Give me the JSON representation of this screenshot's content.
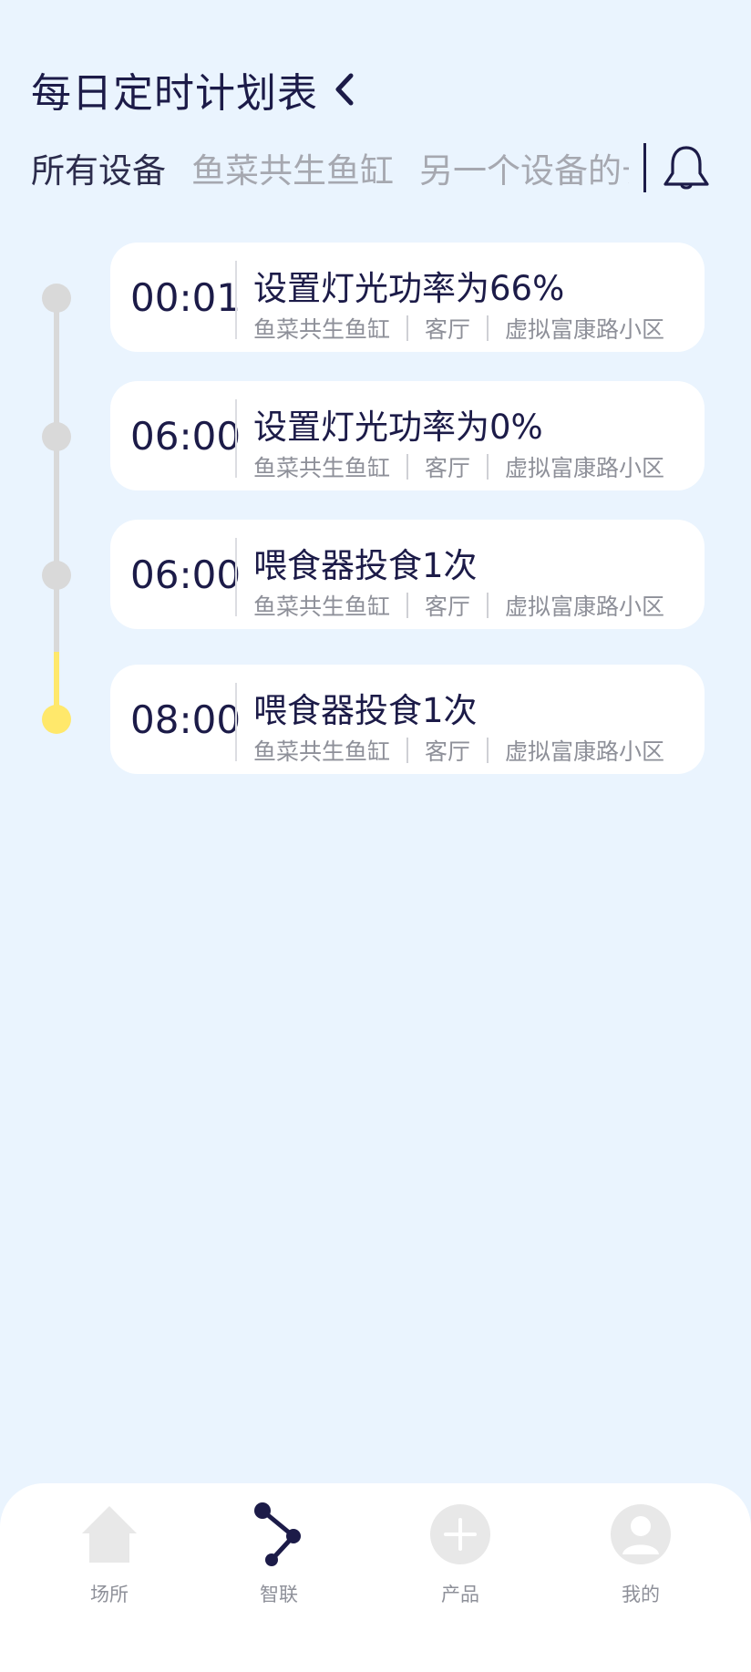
{
  "header": {
    "title": "每日定时计划表"
  },
  "tabs": [
    {
      "label": "所有设备",
      "active": true
    },
    {
      "label": "鱼菜共生鱼缸",
      "active": false
    },
    {
      "label": "另一个设备的长",
      "active": false
    }
  ],
  "schedule": [
    {
      "time": "00:01",
      "action": "设置灯光功率为66%",
      "device": "鱼菜共生鱼缸",
      "room": "客厅",
      "place": "虚拟富康路小区",
      "current": false
    },
    {
      "time": "06:00",
      "action": "设置灯光功率为0%",
      "device": "鱼菜共生鱼缸",
      "room": "客厅",
      "place": "虚拟富康路小区",
      "current": false
    },
    {
      "time": "06:00",
      "action": "喂食器投食1次",
      "device": "鱼菜共生鱼缸",
      "room": "客厅",
      "place": "虚拟富康路小区",
      "current": false
    },
    {
      "time": "08:00",
      "action": "喂食器投食1次",
      "device": "鱼菜共生鱼缸",
      "room": "客厅",
      "place": "虚拟富康路小区",
      "current": true
    }
  ],
  "colors": {
    "background": "#eaf4fe",
    "primary": "#1c1b48",
    "timeline_inactive": "#d9d9d9",
    "timeline_active": "#ffe86b",
    "muted_text": "#8e9099",
    "nav_icon_inactive": "#e8e8e8"
  },
  "nav": [
    {
      "label": "场所",
      "icon": "home-icon",
      "active": false
    },
    {
      "label": "智联",
      "icon": "share-nodes-icon",
      "active": true
    },
    {
      "label": "产品",
      "icon": "plus-circle-icon",
      "active": false
    },
    {
      "label": "我的",
      "icon": "user-icon",
      "active": false
    }
  ]
}
